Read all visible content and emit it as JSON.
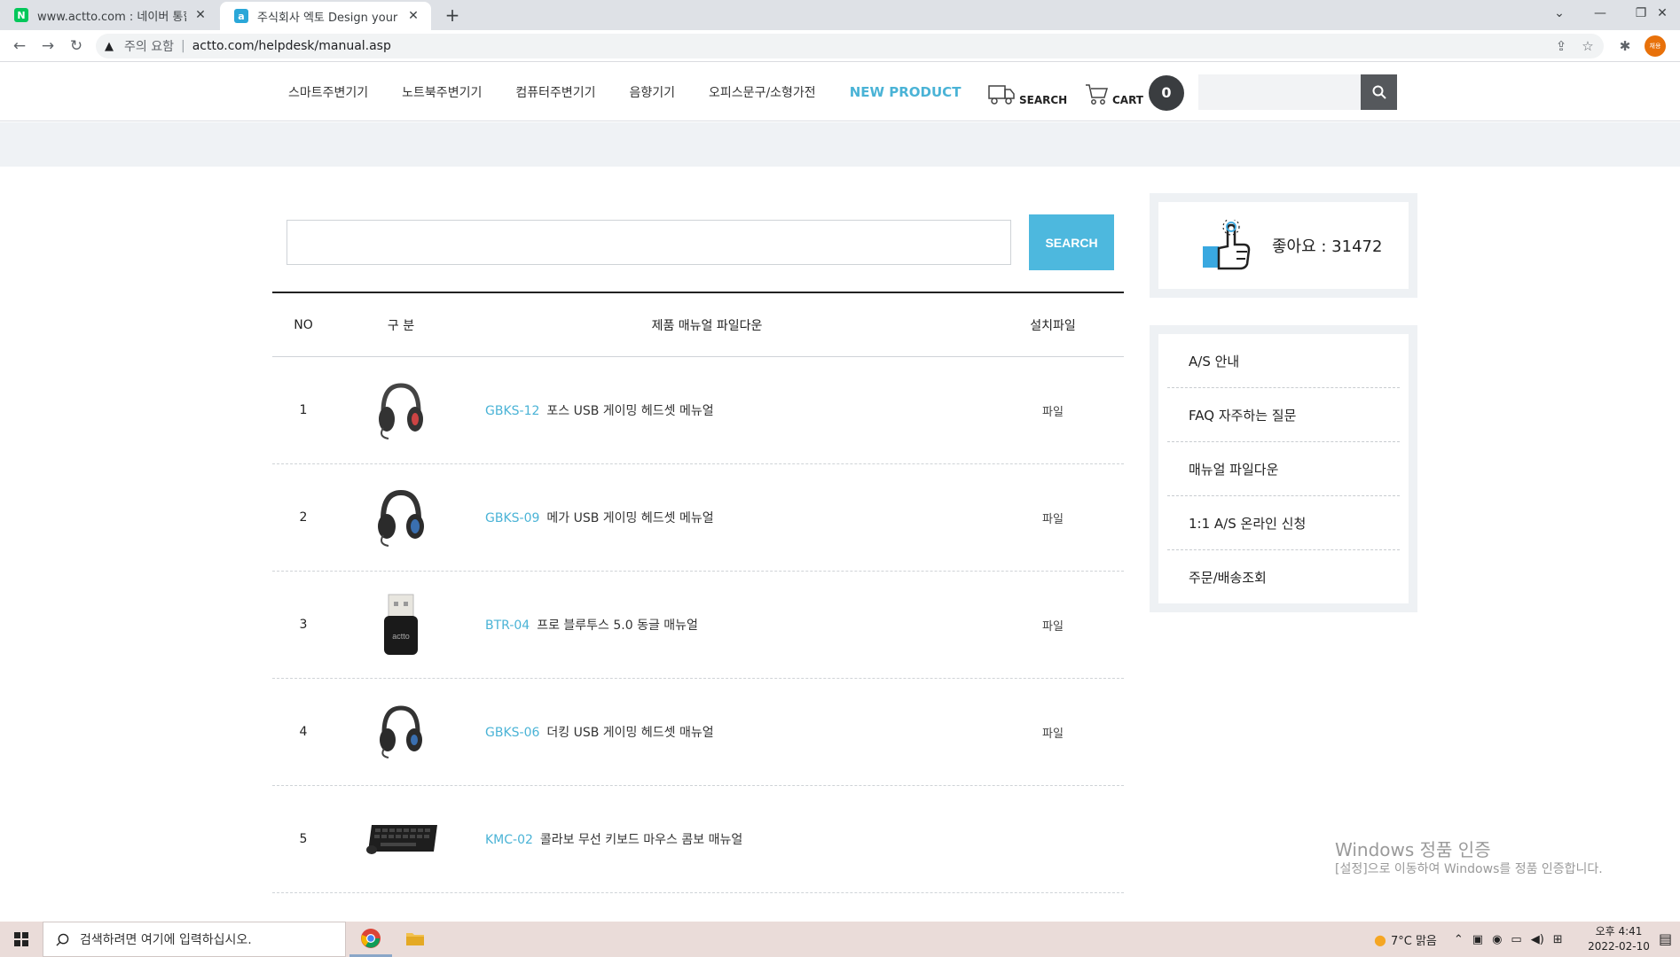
{
  "browser": {
    "tabs": [
      {
        "title": "www.actto.com : 네이버 통합검색",
        "favicon": "N"
      },
      {
        "title": "주식회사 엑토 Design your digital life",
        "favicon": "a"
      }
    ],
    "security_label": "주의 요함",
    "url": "actto.com/helpdesk/manual.asp",
    "profile_label": "채용"
  },
  "header": {
    "nav": [
      "스마트주변기기",
      "노트북주변기기",
      "컴퓨터주변기기",
      "음향기기",
      "오피스문구/소형가전",
      "NEW PRODUCT"
    ],
    "search_label": "SEARCH",
    "cart_label": "CART",
    "cart_count": "0"
  },
  "main": {
    "search_button": "SEARCH",
    "table": {
      "headers": {
        "no": "NO",
        "category": "구 분",
        "title": "제품 매뉴얼 파일다운",
        "file": "설치파일"
      },
      "rows": [
        {
          "no": "1",
          "model": "GBKS-12",
          "desc": "포스 USB 게이밍 헤드셋 메뉴얼",
          "file": "파일",
          "img": "headset-icon"
        },
        {
          "no": "2",
          "model": "GBKS-09",
          "desc": "메가 USB 게이밍 헤드셋 메뉴얼",
          "file": "파일",
          "img": "headset-icon"
        },
        {
          "no": "3",
          "model": "BTR-04",
          "desc": "프로 블루투스 5.0 동글 매뉴얼",
          "file": "파일",
          "img": "dongle-icon"
        },
        {
          "no": "4",
          "model": "GBKS-06",
          "desc": "더킹 USB 게이밍 헤드셋 매뉴얼",
          "file": "파일",
          "img": "headset-icon"
        },
        {
          "no": "5",
          "model": "KMC-02",
          "desc": "콜라보 무선 키보드 마우스 콤보 매뉴얼",
          "file": "",
          "img": "keyboard-icon"
        }
      ]
    }
  },
  "sidebar": {
    "like_text": "좋아요 : 31472",
    "menu": [
      "A/S 안내",
      "FAQ 자주하는 질문",
      "매뉴얼 파일다운",
      "1:1 A/S 온라인 신청",
      "주문/배송조회"
    ]
  },
  "watermark": {
    "title": "Windows 정품 인증",
    "subtitle": "[설정]으로 이동하여 Windows를 정품 인증합니다."
  },
  "taskbar": {
    "search_placeholder": "검색하려면 여기에 입력하십시오.",
    "weather": "7°C  맑음",
    "time": "오후 4:41",
    "date": "2022-02-10"
  }
}
